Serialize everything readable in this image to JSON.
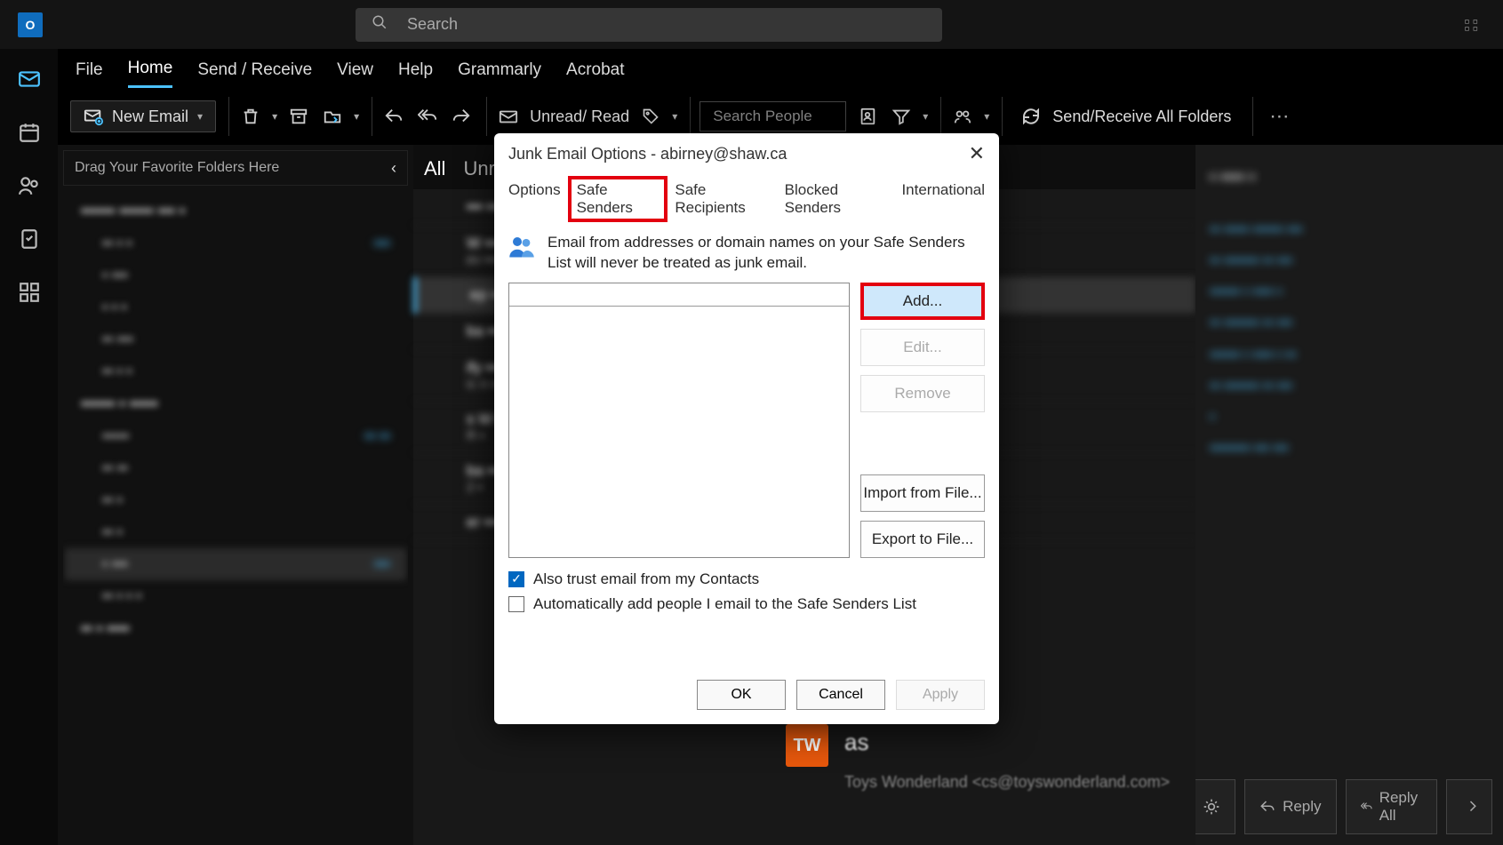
{
  "titlebar": {
    "search_placeholder": "Search"
  },
  "ribbon": {
    "tabs": [
      "File",
      "Home",
      "Send / Receive",
      "View",
      "Help",
      "Grammarly",
      "Acrobat"
    ],
    "active_tab_index": 1,
    "new_email": "New Email",
    "unread_read": "Unread/ Read",
    "search_people": "Search People",
    "send_receive_all": "Send/Receive All Folders"
  },
  "folderpane": {
    "drag_hint": "Drag Your Favorite Folders Here"
  },
  "messagelist": {
    "tab_all": "All",
    "tab_unread": "Unread",
    "footer_from_label": "as",
    "footer_from_text": "Toys Wonderland <cs@toyswonderland.com>",
    "tw_initials": "TW"
  },
  "readingpane": {
    "reply": "Reply",
    "reply_all": "Reply All"
  },
  "dialog": {
    "title": "Junk Email Options - abirney@shaw.ca",
    "tabs": {
      "options": "Options",
      "safe_senders": "Safe Senders",
      "safe_recipients": "Safe Recipients",
      "blocked_senders": "Blocked Senders",
      "international": "International"
    },
    "description": "Email from addresses or domain names on your Safe Senders List will never be treated as junk email.",
    "buttons": {
      "add": "Add...",
      "edit": "Edit...",
      "remove": "Remove",
      "import": "Import from File...",
      "export": "Export to File..."
    },
    "check_trust_contacts": "Also trust email from my Contacts",
    "check_auto_add": "Automatically add people I email to the Safe Senders List",
    "footer": {
      "ok": "OK",
      "cancel": "Cancel",
      "apply": "Apply"
    }
  }
}
